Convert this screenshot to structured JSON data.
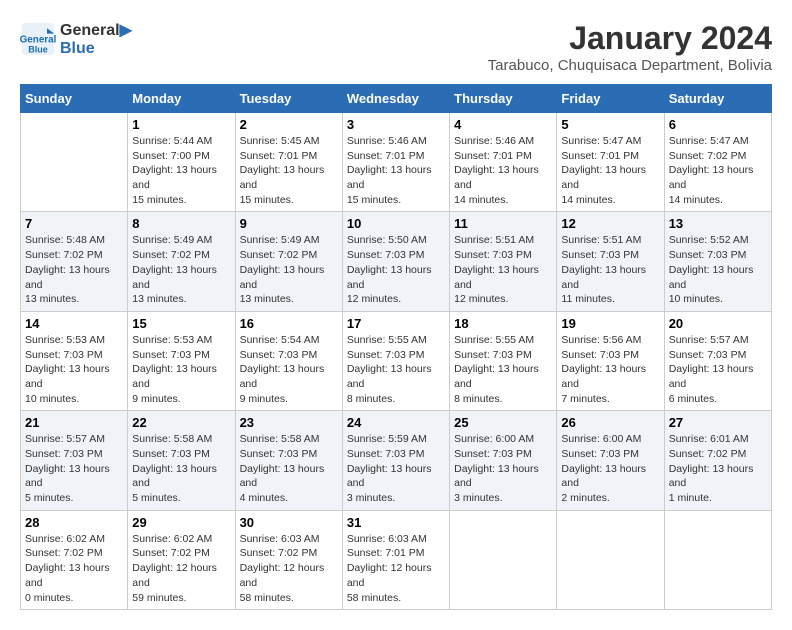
{
  "header": {
    "logo_line1": "General",
    "logo_line2": "Blue",
    "month_year": "January 2024",
    "location": "Tarabuco, Chuquisaca Department, Bolivia"
  },
  "weekdays": [
    "Sunday",
    "Monday",
    "Tuesday",
    "Wednesday",
    "Thursday",
    "Friday",
    "Saturday"
  ],
  "weeks": [
    [
      {
        "day": "",
        "sunrise": "",
        "sunset": "",
        "daylight": ""
      },
      {
        "day": "1",
        "sunrise": "Sunrise: 5:44 AM",
        "sunset": "Sunset: 7:00 PM",
        "daylight": "Daylight: 13 hours and 15 minutes."
      },
      {
        "day": "2",
        "sunrise": "Sunrise: 5:45 AM",
        "sunset": "Sunset: 7:01 PM",
        "daylight": "Daylight: 13 hours and 15 minutes."
      },
      {
        "day": "3",
        "sunrise": "Sunrise: 5:46 AM",
        "sunset": "Sunset: 7:01 PM",
        "daylight": "Daylight: 13 hours and 15 minutes."
      },
      {
        "day": "4",
        "sunrise": "Sunrise: 5:46 AM",
        "sunset": "Sunset: 7:01 PM",
        "daylight": "Daylight: 13 hours and 14 minutes."
      },
      {
        "day": "5",
        "sunrise": "Sunrise: 5:47 AM",
        "sunset": "Sunset: 7:01 PM",
        "daylight": "Daylight: 13 hours and 14 minutes."
      },
      {
        "day": "6",
        "sunrise": "Sunrise: 5:47 AM",
        "sunset": "Sunset: 7:02 PM",
        "daylight": "Daylight: 13 hours and 14 minutes."
      }
    ],
    [
      {
        "day": "7",
        "sunrise": "Sunrise: 5:48 AM",
        "sunset": "Sunset: 7:02 PM",
        "daylight": "Daylight: 13 hours and 13 minutes."
      },
      {
        "day": "8",
        "sunrise": "Sunrise: 5:49 AM",
        "sunset": "Sunset: 7:02 PM",
        "daylight": "Daylight: 13 hours and 13 minutes."
      },
      {
        "day": "9",
        "sunrise": "Sunrise: 5:49 AM",
        "sunset": "Sunset: 7:02 PM",
        "daylight": "Daylight: 13 hours and 13 minutes."
      },
      {
        "day": "10",
        "sunrise": "Sunrise: 5:50 AM",
        "sunset": "Sunset: 7:03 PM",
        "daylight": "Daylight: 13 hours and 12 minutes."
      },
      {
        "day": "11",
        "sunrise": "Sunrise: 5:51 AM",
        "sunset": "Sunset: 7:03 PM",
        "daylight": "Daylight: 13 hours and 12 minutes."
      },
      {
        "day": "12",
        "sunrise": "Sunrise: 5:51 AM",
        "sunset": "Sunset: 7:03 PM",
        "daylight": "Daylight: 13 hours and 11 minutes."
      },
      {
        "day": "13",
        "sunrise": "Sunrise: 5:52 AM",
        "sunset": "Sunset: 7:03 PM",
        "daylight": "Daylight: 13 hours and 10 minutes."
      }
    ],
    [
      {
        "day": "14",
        "sunrise": "Sunrise: 5:53 AM",
        "sunset": "Sunset: 7:03 PM",
        "daylight": "Daylight: 13 hours and 10 minutes."
      },
      {
        "day": "15",
        "sunrise": "Sunrise: 5:53 AM",
        "sunset": "Sunset: 7:03 PM",
        "daylight": "Daylight: 13 hours and 9 minutes."
      },
      {
        "day": "16",
        "sunrise": "Sunrise: 5:54 AM",
        "sunset": "Sunset: 7:03 PM",
        "daylight": "Daylight: 13 hours and 9 minutes."
      },
      {
        "day": "17",
        "sunrise": "Sunrise: 5:55 AM",
        "sunset": "Sunset: 7:03 PM",
        "daylight": "Daylight: 13 hours and 8 minutes."
      },
      {
        "day": "18",
        "sunrise": "Sunrise: 5:55 AM",
        "sunset": "Sunset: 7:03 PM",
        "daylight": "Daylight: 13 hours and 8 minutes."
      },
      {
        "day": "19",
        "sunrise": "Sunrise: 5:56 AM",
        "sunset": "Sunset: 7:03 PM",
        "daylight": "Daylight: 13 hours and 7 minutes."
      },
      {
        "day": "20",
        "sunrise": "Sunrise: 5:57 AM",
        "sunset": "Sunset: 7:03 PM",
        "daylight": "Daylight: 13 hours and 6 minutes."
      }
    ],
    [
      {
        "day": "21",
        "sunrise": "Sunrise: 5:57 AM",
        "sunset": "Sunset: 7:03 PM",
        "daylight": "Daylight: 13 hours and 5 minutes."
      },
      {
        "day": "22",
        "sunrise": "Sunrise: 5:58 AM",
        "sunset": "Sunset: 7:03 PM",
        "daylight": "Daylight: 13 hours and 5 minutes."
      },
      {
        "day": "23",
        "sunrise": "Sunrise: 5:58 AM",
        "sunset": "Sunset: 7:03 PM",
        "daylight": "Daylight: 13 hours and 4 minutes."
      },
      {
        "day": "24",
        "sunrise": "Sunrise: 5:59 AM",
        "sunset": "Sunset: 7:03 PM",
        "daylight": "Daylight: 13 hours and 3 minutes."
      },
      {
        "day": "25",
        "sunrise": "Sunrise: 6:00 AM",
        "sunset": "Sunset: 7:03 PM",
        "daylight": "Daylight: 13 hours and 3 minutes."
      },
      {
        "day": "26",
        "sunrise": "Sunrise: 6:00 AM",
        "sunset": "Sunset: 7:03 PM",
        "daylight": "Daylight: 13 hours and 2 minutes."
      },
      {
        "day": "27",
        "sunrise": "Sunrise: 6:01 AM",
        "sunset": "Sunset: 7:02 PM",
        "daylight": "Daylight: 13 hours and 1 minute."
      }
    ],
    [
      {
        "day": "28",
        "sunrise": "Sunrise: 6:02 AM",
        "sunset": "Sunset: 7:02 PM",
        "daylight": "Daylight: 13 hours and 0 minutes."
      },
      {
        "day": "29",
        "sunrise": "Sunrise: 6:02 AM",
        "sunset": "Sunset: 7:02 PM",
        "daylight": "Daylight: 12 hours and 59 minutes."
      },
      {
        "day": "30",
        "sunrise": "Sunrise: 6:03 AM",
        "sunset": "Sunset: 7:02 PM",
        "daylight": "Daylight: 12 hours and 58 minutes."
      },
      {
        "day": "31",
        "sunrise": "Sunrise: 6:03 AM",
        "sunset": "Sunset: 7:01 PM",
        "daylight": "Daylight: 12 hours and 58 minutes."
      },
      {
        "day": "",
        "sunrise": "",
        "sunset": "",
        "daylight": ""
      },
      {
        "day": "",
        "sunrise": "",
        "sunset": "",
        "daylight": ""
      },
      {
        "day": "",
        "sunrise": "",
        "sunset": "",
        "daylight": ""
      }
    ]
  ]
}
